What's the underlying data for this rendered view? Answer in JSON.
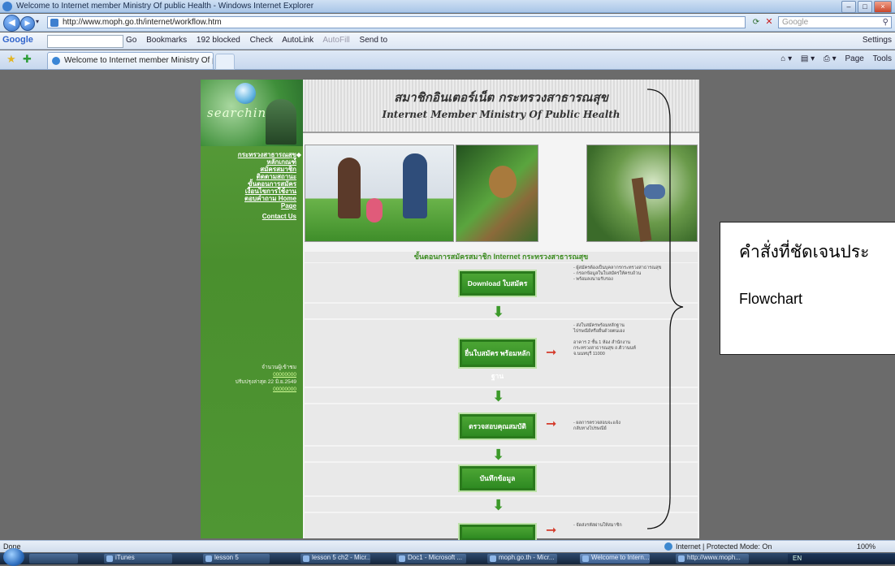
{
  "browser": {
    "window_title": "Welcome to Internet member Ministry Of public Health - Windows Internet Explorer",
    "url": "http://www.moph.go.th/internet/workflow.htm",
    "search_placeholder": "Google",
    "tab_title": "Welcome to Internet member Ministry Of public ...",
    "status_left": "Done",
    "status_zone": "Internet | Protected Mode: On",
    "zoom": "100%"
  },
  "google_toolbar": {
    "label": "Google",
    "items": [
      "Go",
      "Bookmarks",
      "192 blocked",
      "Check",
      "AutoLink",
      "AutoFill",
      "Send to"
    ],
    "settings": "Settings"
  },
  "command_bar": {
    "page": "Page",
    "tools": "Tools"
  },
  "page": {
    "header_th": "สมาชิกอินเตอร์เน็ต กระทรวงสาธารณสุข",
    "header_en": "Internet Member Ministry Of Public Health",
    "logo_word": "searching",
    "menu": [
      "กระทรวงสาธารณสุข",
      "หลักเกณฑ์",
      "สมัครสมาชิก",
      "ติดตามสถานะ",
      "ขั้นตอนการสมัคร",
      "เงื่อนไขการใช้งาน",
      "ตอบคำถาม Home",
      "Page",
      "Contact Us"
    ],
    "counter_label": "จำนวนผู้เข้าชม",
    "counter_value": "00000000",
    "updated_label": "ปรับปรุงล่าสุด 22 มิ.ย.2549",
    "updated_link": "00000000",
    "flow_title": "ขั้นตอนการสมัครสมาชิก Internet กระทรวงสาธารณสุข",
    "flow_boxes": [
      "Download ใบสมัคร",
      "ยื่นใบสมัคร พร้อมหลักฐาน",
      "ตรวจสอบคุณสมบัติ",
      "บันทึกข้อมูล"
    ],
    "notes": [
      "- ผู้สมัครต้องเป็นบุคลากรกระทรวงสาธารณสุข\n- กรอกข้อมูลในใบสมัครให้ครบถ้วน\n- พร้อมลงนามรับรอง",
      "- ส่งใบสมัครพร้อมหลักฐาน\nไปรษณีย์หรือยื่นด้วยตนเอง\n\nอาคาร 2 ชั้น 1 ห้อง สำนักงาน\nกระทรวงสาธารณสุข ถ.ติวานนท์\nจ.นนทบุรี 11000",
      "- ผลการตรวจสอบจะแจ้ง\nกลับทางไปรษณีย์",
      "- จัดส่งรหัสผ่านให้สมาชิก"
    ]
  },
  "callout": {
    "line1": "คำสั่งที่ชัดเจนประ",
    "line2": "Flowchart"
  },
  "taskbar": {
    "buttons": [
      "iTunes",
      "lesson 5",
      "lesson 5 ch2 - Micr...",
      "Doc1 - Microsoft ...",
      "moph.go.th - Micr...",
      "Welcome to Intern...",
      "http://www.moph..."
    ],
    "active_index": 5,
    "tray_text": "EN"
  }
}
